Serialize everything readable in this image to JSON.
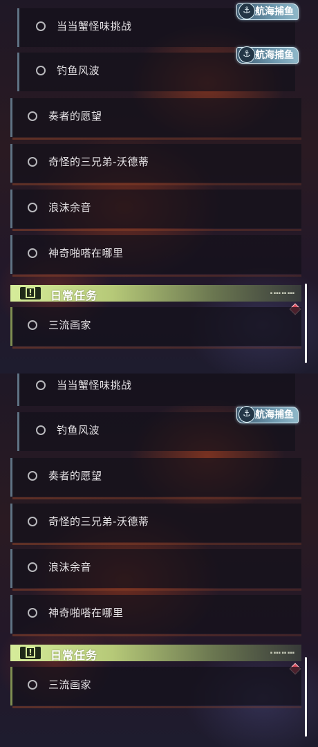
{
  "quest_list": {
    "sub_quests": [
      {
        "label": "当当蟹怪味挑战",
        "tag": "航海捕鱼"
      },
      {
        "label": "钓鱼风波",
        "tag": "航海捕鱼"
      }
    ],
    "main_quests": [
      {
        "label": "奏者的愿望"
      },
      {
        "label": "奇怪的三兄弟-沃德蒂"
      },
      {
        "label": "浪沫余音"
      },
      {
        "label": "神奇啪嗒在哪里"
      }
    ],
    "daily_header": {
      "title": "日常任务",
      "warn_glyph": "!"
    },
    "daily_quests": [
      {
        "label": "三流画家"
      }
    ],
    "anchor_glyph": "⚓"
  }
}
